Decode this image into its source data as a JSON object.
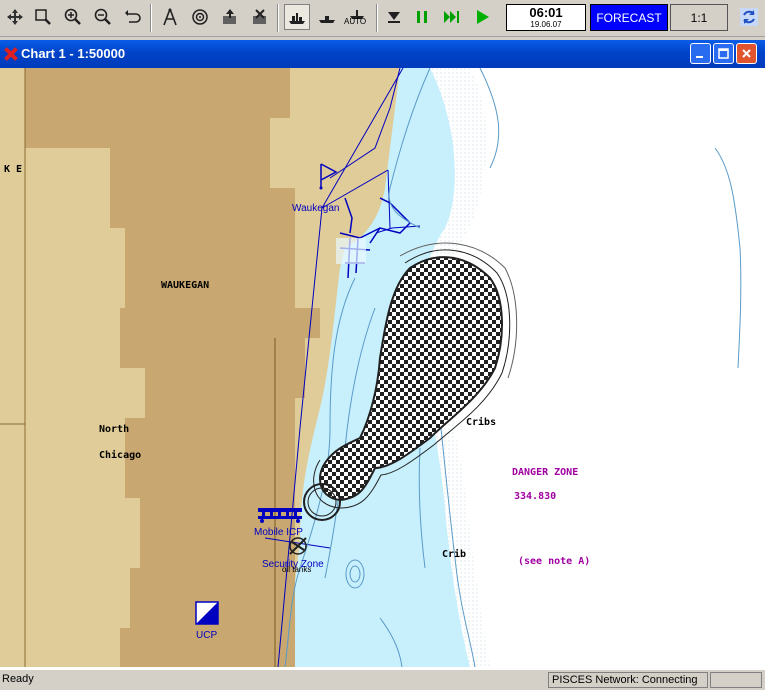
{
  "toolbar": {
    "icons": [
      "pan-icon",
      "zoom-window-icon",
      "zoom-in-icon",
      "zoom-out-icon",
      "undo-icon",
      "compass-icon",
      "target-icon",
      "export-icon",
      "import-icon",
      "ship-view-icon",
      "ship-flat-icon",
      "auto-icon",
      "stop-icon",
      "pause-icon",
      "fast-forward-icon",
      "play-icon",
      "sync-icon"
    ],
    "auto_label": "AUTO",
    "clock_time": "06:01",
    "clock_date": "19.06.07",
    "forecast_label": "FORECAST",
    "scale_label": "1:1"
  },
  "window": {
    "title": "Chart 1 - 1:50000",
    "minimize": "_",
    "maximize": "□",
    "close": "✕"
  },
  "map": {
    "labels": {
      "ke": "K E",
      "waukegan_town": "WAUKEGAN",
      "north": "North",
      "chicago": "Chicago",
      "waukegan_harbor": "Waukegan",
      "cribs": "Cribs",
      "crib": "Crib",
      "danger_zone": "DANGER ZONE",
      "danger_code": "334.830",
      "see_note": "(see note A)",
      "mobile_icp": "Mobile ICP",
      "security_zone": "Security Zone",
      "oil_tanks": "oil tanks",
      "ucp": "UCP"
    },
    "colors": {
      "land_dark": "#c8a870",
      "land_light": "#e0cc98",
      "shallow_water": "#c8f0fc",
      "deep_water": "#ffffff",
      "route": "#0000c0",
      "danger_text": "#a000a0"
    }
  },
  "status": {
    "left": "Ready",
    "network": "PISCES Network: Connecting"
  }
}
